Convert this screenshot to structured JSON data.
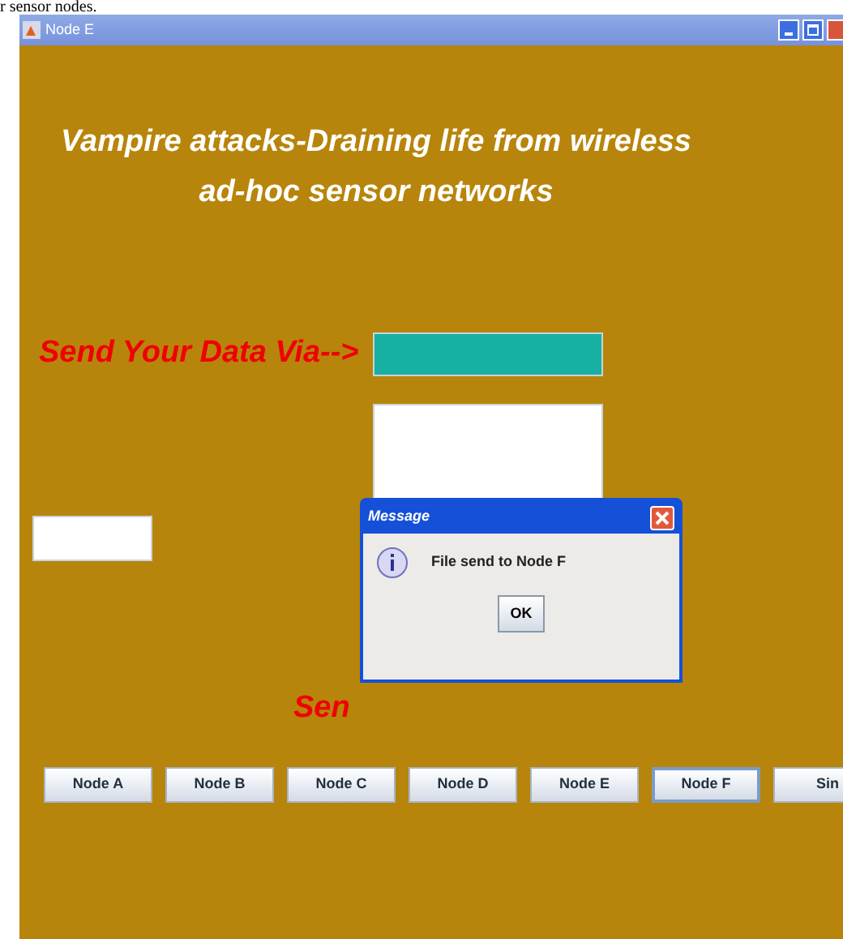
{
  "caption": "r sensor nodes.",
  "window": {
    "title": "Node E"
  },
  "heading": [
    "Vampire attacks-Draining life from wireless",
    "ad-hoc sensor networks"
  ],
  "send_label": "Send Your Data Via-->",
  "send_label_2": "Sen",
  "buttons": [
    {
      "label": "Node A",
      "selected": false
    },
    {
      "label": "Node B",
      "selected": false
    },
    {
      "label": "Node C",
      "selected": false
    },
    {
      "label": "Node D",
      "selected": false
    },
    {
      "label": "Node E",
      "selected": false
    },
    {
      "label": "Node F",
      "selected": true
    },
    {
      "label": "Sin",
      "selected": false
    }
  ],
  "dialog": {
    "title": "Message",
    "message": "File send to Node F",
    "button": "OK"
  }
}
